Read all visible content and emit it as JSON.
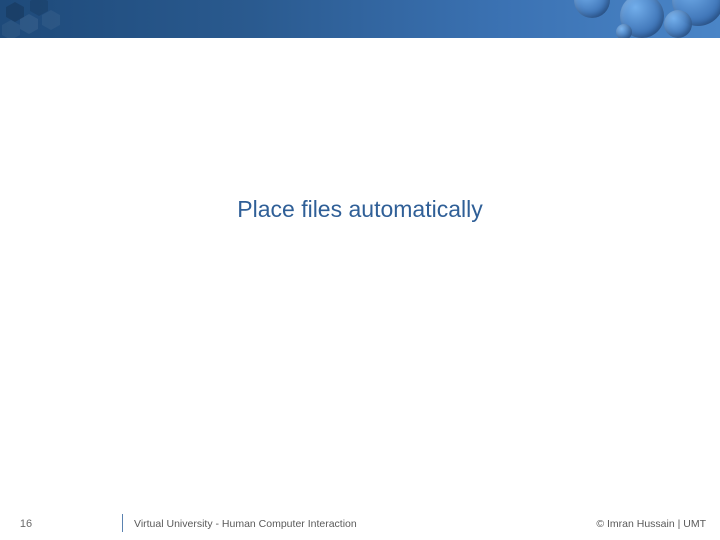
{
  "main": {
    "title": "Place files automatically"
  },
  "footer": {
    "page_number": "16",
    "left_text": "Virtual University - Human Computer Interaction",
    "right_text": "© Imran Hussain | UMT"
  }
}
